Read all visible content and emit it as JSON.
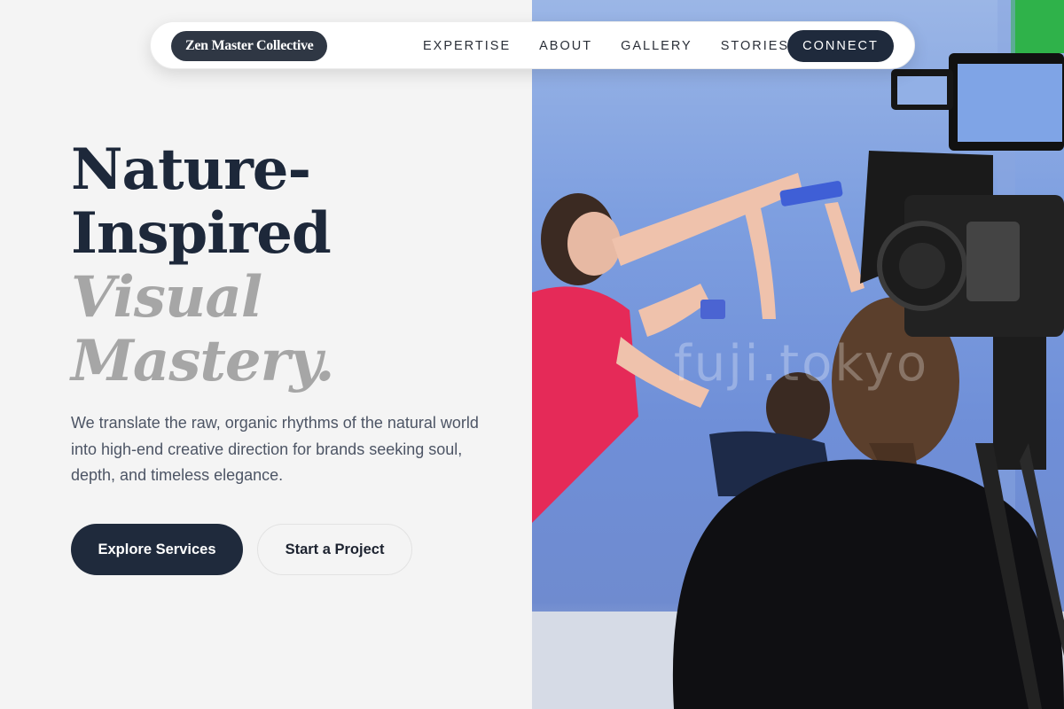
{
  "nav": {
    "brand": "Zen Master Collective",
    "links": [
      {
        "label": "EXPERTISE"
      },
      {
        "label": "ABOUT"
      },
      {
        "label": "GALLERY"
      },
      {
        "label": "STORIES"
      }
    ],
    "cta_label": "CONNECT"
  },
  "hero": {
    "title_lines": [
      "Nature-",
      "Inspired"
    ],
    "accent_lines": [
      "Visual",
      "Mastery."
    ],
    "description": "We translate the raw, organic rhythms of the natural world into high-end creative direction for brands seeking soul, depth, and timeless elegance.",
    "primary_button": "Explore Services",
    "secondary_button": "Start a Project"
  },
  "photo": {
    "watermark": "fuji.tokyo",
    "subject": "film crew shooting in front of blue screen with camera rig"
  },
  "colors": {
    "navy": "#1f2a3c",
    "brand_pill": "#2f3744",
    "muted_heading": "#a6a6a6",
    "background": "#f4f4f4"
  }
}
